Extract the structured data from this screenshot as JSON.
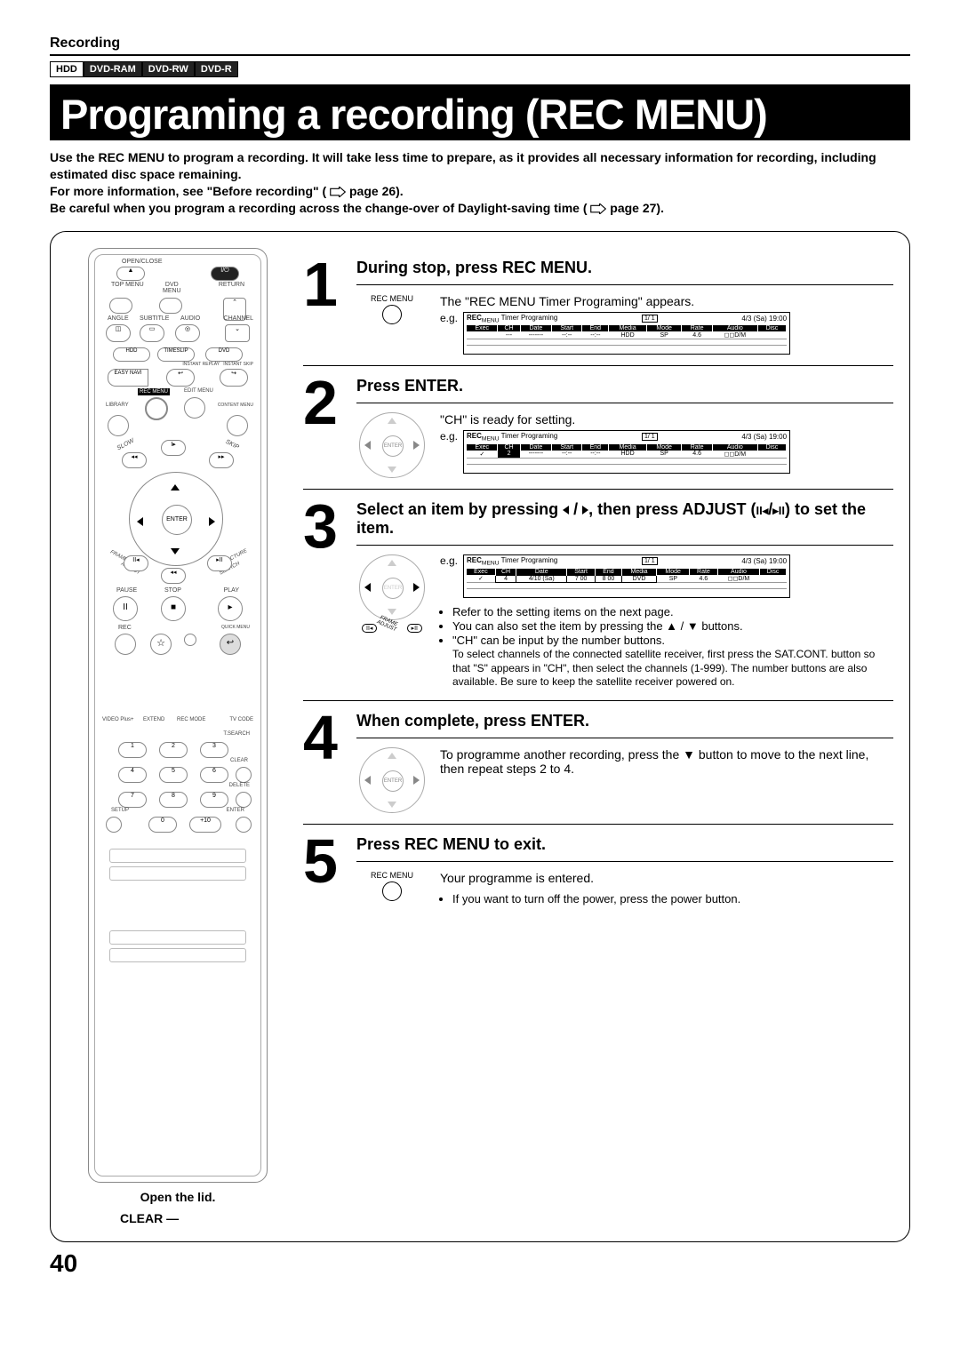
{
  "header": {
    "section": "Recording",
    "badges": [
      "HDD",
      "DVD-RAM",
      "DVD-RW",
      "DVD-R"
    ],
    "title": "Programing a recording (REC MENU)"
  },
  "intro": {
    "line1": "Use the REC MENU to program a recording. It will take less time to prepare, as it provides all necessary information for recording, including estimated disc space remaining.",
    "line2a": "For more information, see \"Before recording\" (",
    "line2b": " page 26).",
    "line3a": "Be careful when you program a recording across the change-over of Daylight-saving time (",
    "line3b": " page 27)."
  },
  "remote_labels": {
    "open_lid": "Open the lid.",
    "clear": "CLEAR"
  },
  "steps": [
    {
      "num": "1",
      "title": "During stop, press REC MENU.",
      "icon_label": "REC MENU",
      "desc": "The \"REC MENU Timer Programing\" appears.",
      "eg": "e.g.",
      "ui": {
        "title_a": "REC",
        "title_b": "MENU",
        "title_c": "Timer Programing",
        "page": "1/ 1",
        "datetime": "4/3 (Sa) 19:00",
        "cols": [
          "Exec",
          "CH",
          "Date",
          "Start",
          "End",
          "Media",
          "Mode",
          "Rate",
          "Audio",
          "Disc"
        ],
        "rows": [
          [
            "",
            "---",
            "-------",
            "--:--",
            "--:--",
            "HDD",
            "SP",
            "4.6",
            "◻◻D/M",
            ""
          ]
        ]
      }
    },
    {
      "num": "2",
      "title": "Press ENTER.",
      "nav_center": "ENTER",
      "desc": "\"CH\" is ready for setting.",
      "eg": "e.g.",
      "ui": {
        "title_a": "REC",
        "title_b": "MENU",
        "title_c": "Timer Programing",
        "page": "1/ 1",
        "datetime": "4/3 (Sa) 19:00",
        "cols": [
          "Exec",
          "CH",
          "Date",
          "Start",
          "End",
          "Media",
          "Mode",
          "Rate",
          "Audio",
          "Disc"
        ],
        "rows": [
          [
            "✓",
            "2",
            "-------",
            "--:--",
            "--:--",
            "HDD",
            "SP",
            "4.6",
            "◻◻D/M",
            ""
          ]
        ]
      }
    },
    {
      "num": "3",
      "title_a": "Select an item by pressing ",
      "title_b": " / ",
      "title_c": ", then press ADJUST (",
      "title_d": ") to set the item.",
      "nav_center": "ENTER",
      "eg": "e.g.",
      "ui": {
        "title_a": "REC",
        "title_b": "MENU",
        "title_c": "Timer Programing",
        "page": "1/ 1",
        "datetime": "4/3 (Sa) 19:00",
        "cols": [
          "Exec",
          "CH",
          "Date",
          "Start",
          "End",
          "Media",
          "Mode",
          "Rate",
          "Audio",
          "Disc"
        ],
        "rows": [
          [
            "✓",
            "4",
            "4/10 (Sa)",
            "7 00",
            "8 00",
            "DVD",
            "SP",
            "4.6",
            "◻◻D/M",
            ""
          ]
        ]
      },
      "bullets": [
        "Refer to the setting items on the next page.",
        "You can also set the item by pressing the ▲ / ▼ buttons.",
        "\"CH\" can be input by the number buttons."
      ],
      "subnote": "To select channels of the connected satellite receiver, first press the SAT.CONT. button so that \"S\" appears in \"CH\", then select the channels (1-999). The number buttons are also available. Be sure to keep the satellite receiver powered on."
    },
    {
      "num": "4",
      "title": "When complete, press ENTER.",
      "nav_center": "ENTER",
      "desc": "To programme another recording, press the ▼ button to move to the next line, then repeat steps 2 to 4."
    },
    {
      "num": "5",
      "title": "Press REC MENU to exit.",
      "icon_label": "REC MENU",
      "desc": "Your programme is entered.",
      "bullets": [
        "If you want to turn off the power, press the power button."
      ]
    }
  ],
  "page_number": "40",
  "remote_glyphs": {
    "open_close": "OPEN/CLOSE",
    "top_menu": "TOP MENU",
    "dvd": "DVD",
    "menu": "MENU",
    "return": "RETURN",
    "angle": "ANGLE",
    "subtitle": "SUBTITLE",
    "audio": "AUDIO",
    "channel": "CHANNEL",
    "hdd": "HDD",
    "timeslip": "TIMESLIP",
    "dvd2": "DVD",
    "easy_navi": "EASY NAVI",
    "instant_replay": "INSTANT REPLAY",
    "instant_skip": "INSTANT SKIP",
    "rec_menu": "REC MENU",
    "edit_menu": "EDIT MENU",
    "library": "LIBRARY",
    "content_menu": "CONTENT MENU",
    "slow": "SLOW",
    "skip": "SKIP",
    "enter": "ENTER",
    "frame": "FRAME",
    "adjust": "ADJUST",
    "picture": "PICTURE",
    "search": "SEARCH",
    "pause": "PAUSE",
    "stop": "STOP",
    "play": "PLAY",
    "rec": "REC",
    "quickmenu": "QUICK MENU",
    "vplus": "VIDEO Plus+",
    "extend": "EXTEND",
    "recmode": "REC MODE",
    "tvcode": "TV CODE",
    "tsearch": "T.SEARCH",
    "clear": "CLEAR",
    "delete": "DELETE",
    "setup": "SETUP",
    "enter2": "ENTER"
  }
}
